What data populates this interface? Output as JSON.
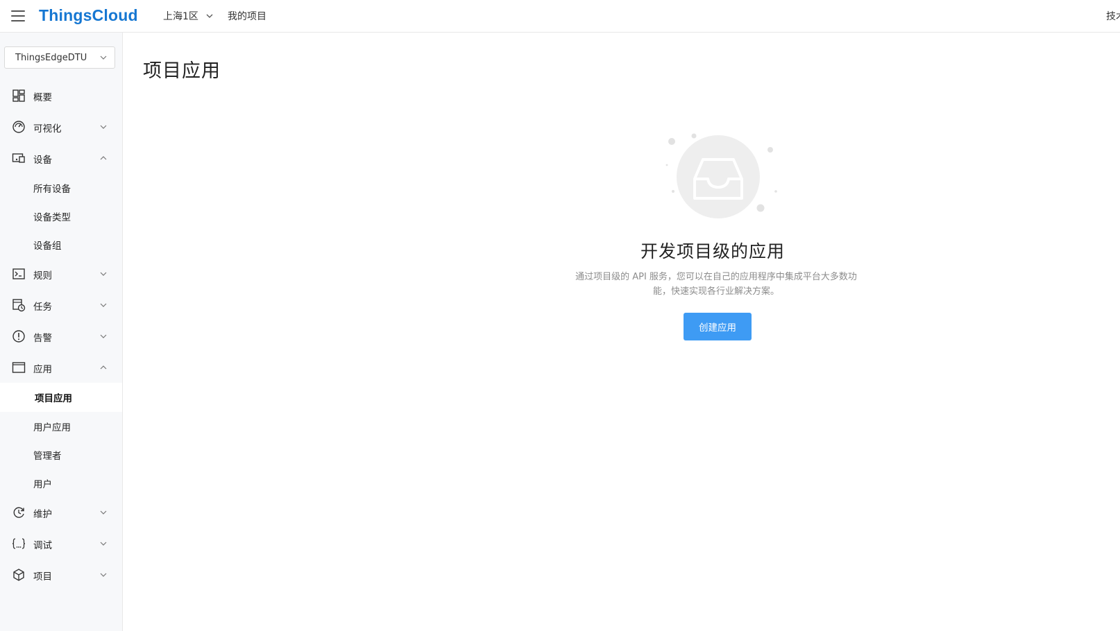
{
  "header": {
    "logo": "ThingsCloud",
    "region": "上海1区",
    "my_projects": "我的项目",
    "right_text": "技术"
  },
  "sidebar": {
    "project_select": "ThingsEdgeDTU",
    "nav": {
      "overview": "概要",
      "visualization": "可视化",
      "devices": "设备",
      "all_devices": "所有设备",
      "device_types": "设备类型",
      "device_groups": "设备组",
      "rules": "规则",
      "tasks": "任务",
      "alerts": "告警",
      "apps": "应用",
      "project_apps": "项目应用",
      "user_apps": "用户应用",
      "managers": "管理者",
      "users": "用户",
      "maintenance": "维护",
      "debug": "调试",
      "project": "项目"
    }
  },
  "main": {
    "page_title": "项目应用",
    "empty_title": "开发项目级的应用",
    "empty_desc_line1": "通过项目级的 API 服务，您可以在自己的应用程序中集成平台大多数功",
    "empty_desc_line2": "能，快速实现各行业解决方案。",
    "create_button": "创建应用"
  },
  "colors": {
    "brand": "#1677d2",
    "primary_button": "#3e9bf4",
    "sidebar_bg": "#f7f8fa"
  }
}
